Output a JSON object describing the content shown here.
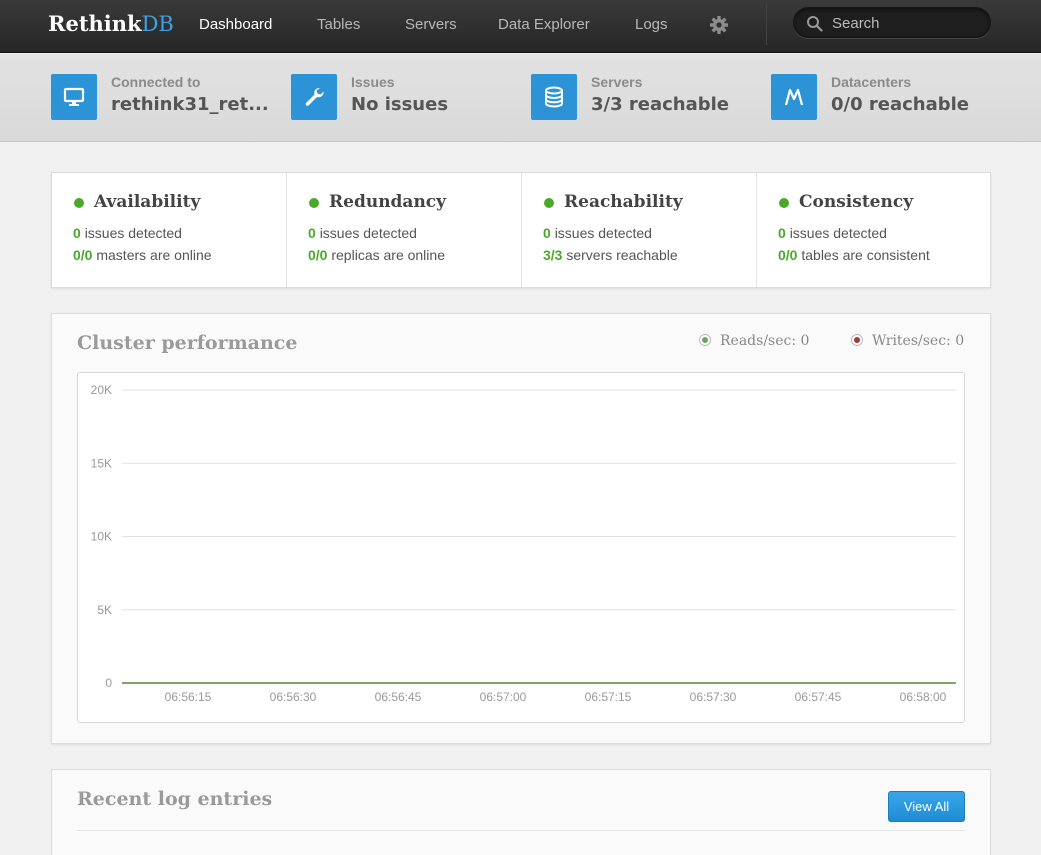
{
  "nav": {
    "brand_main": "Rethink",
    "brand_accent": "DB",
    "items": [
      {
        "label": "Dashboard",
        "active": true
      },
      {
        "label": "Tables",
        "active": false
      },
      {
        "label": "Servers",
        "active": false
      },
      {
        "label": "Data Explorer",
        "active": false
      },
      {
        "label": "Logs",
        "active": false
      }
    ],
    "settings_icon": "gear-icon",
    "search_placeholder": "Search"
  },
  "status": [
    {
      "label": "Connected to",
      "value": "rethink31_ret...",
      "icon": "monitor-icon"
    },
    {
      "label": "Issues",
      "value": "No issues",
      "icon": "wrench-icon"
    },
    {
      "label": "Servers",
      "value": "3/3 reachable",
      "icon": "database-icon"
    },
    {
      "label": "Datacenters",
      "value": "0/0 reachable",
      "icon": "datacenter-icon"
    }
  ],
  "health": [
    {
      "title": "Availability",
      "count1": "0",
      "text1": "issues detected",
      "count2": "0/0",
      "text2": "masters are online"
    },
    {
      "title": "Redundancy",
      "count1": "0",
      "text1": "issues detected",
      "count2": "0/0",
      "text2": "replicas are online"
    },
    {
      "title": "Reachability",
      "count1": "0",
      "text1": "issues detected",
      "count2": "3/3",
      "text2": "servers reachable"
    },
    {
      "title": "Consistency",
      "count1": "0",
      "text1": "issues detected",
      "count2": "0/0",
      "text2": "tables are consistent"
    }
  ],
  "performance": {
    "title": "Cluster performance",
    "reads_label": "Reads/sec: 0",
    "writes_label": "Writes/sec: 0"
  },
  "chart_data": {
    "type": "line",
    "title": "Cluster performance",
    "x": [
      "06:56:15",
      "06:56:30",
      "06:56:45",
      "06:57:00",
      "06:57:15",
      "06:57:30",
      "06:57:45",
      "06:58:00"
    ],
    "y_ticks": [
      "0",
      "5K",
      "10K",
      "15K",
      "20K"
    ],
    "ylim": [
      0,
      20000
    ],
    "series": [
      {
        "name": "Reads/sec",
        "values": [
          0,
          0,
          0,
          0,
          0,
          0,
          0,
          0
        ],
        "color": "#6aa84f"
      },
      {
        "name": "Writes/sec",
        "values": [
          0,
          0,
          0,
          0,
          0,
          0,
          0,
          0
        ],
        "color": "#a33a3a"
      }
    ],
    "grid": true
  },
  "logs": {
    "title": "Recent log entries",
    "view_all_label": "View All"
  },
  "colors": {
    "accent": "#2b93d6",
    "ok_green": "#4aa92a",
    "nav_bg": "#2e2e2e"
  }
}
